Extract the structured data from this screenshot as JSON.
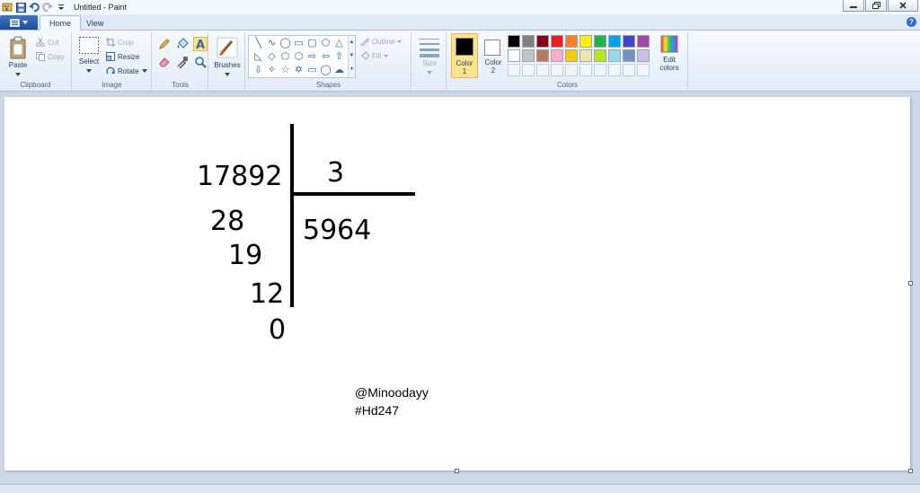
{
  "window": {
    "title": "Untitled - Paint"
  },
  "tabs": [
    {
      "label": "Home",
      "active": true
    },
    {
      "label": "View",
      "active": false
    }
  ],
  "clipboard": {
    "group_label": "Clipboard",
    "paste": "Paste",
    "cut": "Cut",
    "copy": "Copy"
  },
  "image": {
    "group_label": "Image",
    "select": "Select",
    "crop": "Crop",
    "resize": "Resize",
    "rotate": "Rotate"
  },
  "tools": {
    "group_label": "Tools"
  },
  "brushes": {
    "label": "Brushes"
  },
  "shapes": {
    "group_label": "Shapes",
    "outline": "Outline",
    "fill": "Fill"
  },
  "size": {
    "label": "Size"
  },
  "colors": {
    "group_label": "Colors",
    "color1_label": "Color 1",
    "color1_num": "1",
    "color1_word": "Color",
    "color2_word": "Color",
    "color2_num": "2",
    "color1_value": "#000000",
    "color2_value": "#ffffff",
    "edit_colors_1": "Edit",
    "edit_colors_2": "colors",
    "palette_row1": [
      "#000000",
      "#7f7f7f",
      "#880015",
      "#ed1c24",
      "#ff7f27",
      "#fff200",
      "#22b14c",
      "#00a2e8",
      "#3f48cc",
      "#a349a4"
    ],
    "palette_row2": [
      "#ffffff",
      "#c3c3c3",
      "#b97a57",
      "#ffaec9",
      "#ffc90e",
      "#efe4b0",
      "#b5e61d",
      "#99d9ea",
      "#7092be",
      "#c8bfe7"
    ]
  },
  "canvas": {
    "dividend": "17892",
    "divisor": "3",
    "quotient": "5964",
    "step1": "28",
    "step2": "19",
    "step3": "12",
    "remainder": "0",
    "watermark_1": "@Minoodayy",
    "watermark_2": "#Hd247"
  }
}
